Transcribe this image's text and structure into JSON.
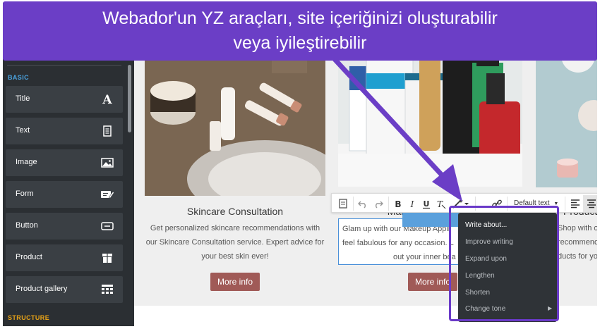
{
  "banner": {
    "line1": "Webador'un YZ araçları, site içeriğinizi oluşturabilir",
    "line2": "veya iyileştirebilir"
  },
  "sidebar": {
    "section_basic": "BASIC",
    "section_structure": "STRUCTURE",
    "items": [
      {
        "label": "Title",
        "icon": "title-icon"
      },
      {
        "label": "Text",
        "icon": "text-icon"
      },
      {
        "label": "Image",
        "icon": "image-icon"
      },
      {
        "label": "Form",
        "icon": "form-icon"
      },
      {
        "label": "Button",
        "icon": "button-icon"
      },
      {
        "label": "Product",
        "icon": "product-icon"
      },
      {
        "label": "Product gallery",
        "icon": "product-gallery-icon"
      }
    ]
  },
  "cards": [
    {
      "title": "Skincare Consultation",
      "desc1": "Get personalized skincare recommendations with",
      "desc2": "our Skincare Consultation service. Expert advice for",
      "desc3": "your best skin ever!",
      "button": "More info"
    },
    {
      "title": "Makeup Application",
      "desc1": "Glam up with our Makeup Appli",
      "desc2": "feel fabulous for any occasion. L",
      "desc3": "out your inner bea",
      "button": "More info"
    },
    {
      "title": "Product",
      "desc1": "Shop with o",
      "desc2": "recommenda",
      "desc3": "ducts for yo"
    }
  ],
  "toolbar": {
    "style_label": "Default text"
  },
  "ai_menu": {
    "items": [
      "Write about...",
      "Improve writing",
      "Expand upon",
      "Lengthen",
      "Shorten",
      "Change tone"
    ]
  },
  "colors": {
    "banner": "#6b3ec6",
    "sidebar": "#2b2f33",
    "sidebar_item": "#3a3f44",
    "section_label": "#4aa3df",
    "structure_label": "#e8a317",
    "button": "#a05a57",
    "menu": "#2f3337"
  }
}
